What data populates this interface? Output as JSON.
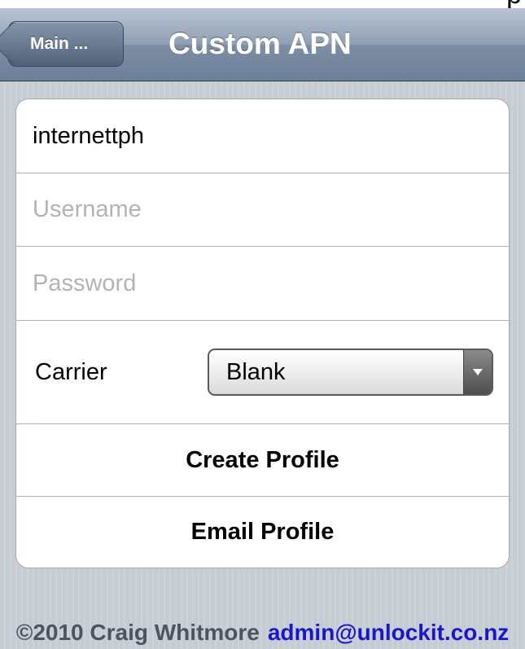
{
  "top_strip": {
    "text": "p"
  },
  "nav": {
    "back_label": "Main ...",
    "title": "Custom APN"
  },
  "form": {
    "apn_value": "internettph",
    "username_placeholder": "Username",
    "password_placeholder": "Password",
    "carrier_label": "Carrier",
    "carrier_selected": "Blank",
    "create_profile_label": "Create Profile",
    "email_profile_label": "Email Profile"
  },
  "footer": {
    "copyright": "©2010 Craig Whitmore",
    "email": "admin@unlockit.co.nz"
  },
  "colors": {
    "navbar": "#7d8ea5",
    "background": "#c5ccd4",
    "link": "#1a17c9"
  }
}
